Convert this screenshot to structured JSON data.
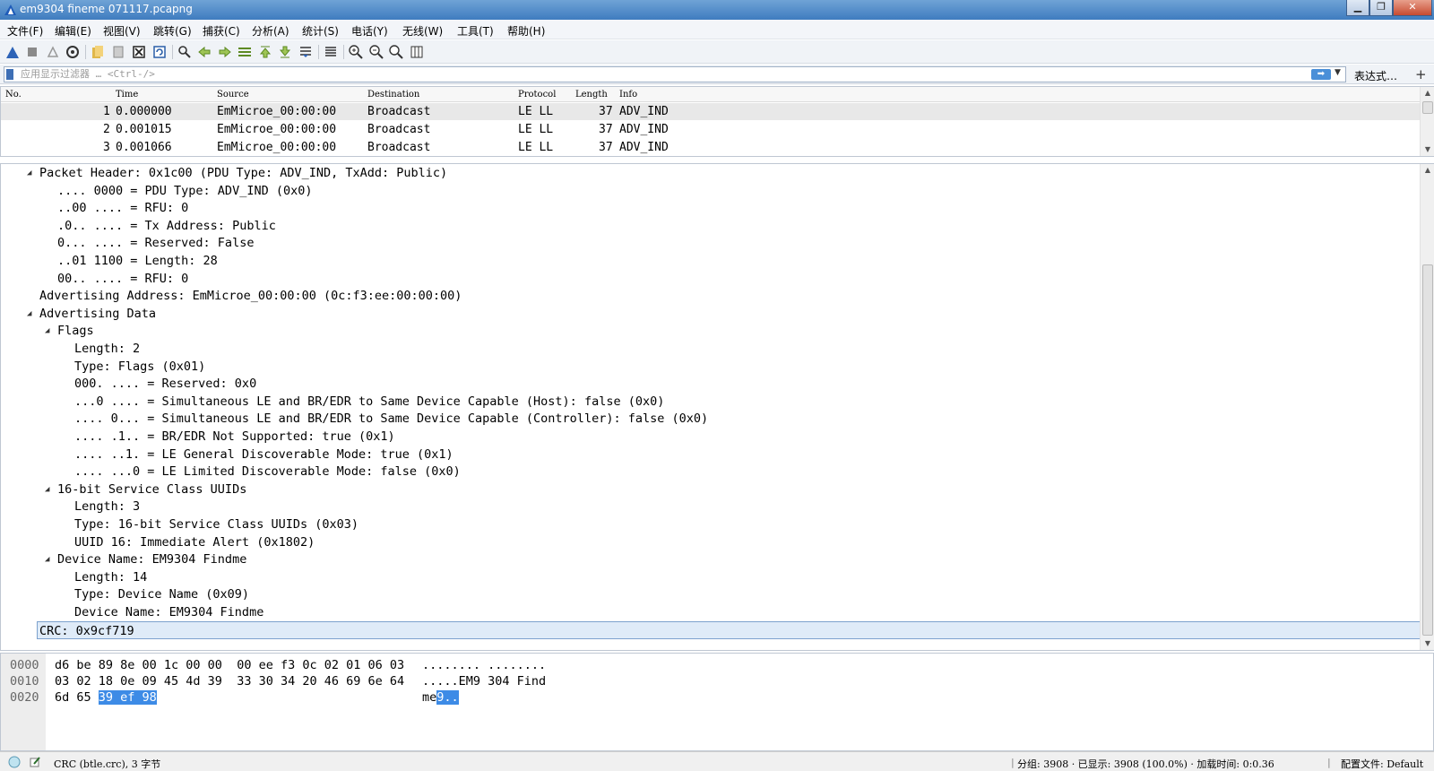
{
  "window": {
    "title": "em9304 fineme 071117.pcapng"
  },
  "menu": [
    "文件(F)",
    "编辑(E)",
    "视图(V)",
    "跳转(G)",
    "捕获(C)",
    "分析(A)",
    "统计(S)",
    "电话(Y)",
    "无线(W)",
    "工具(T)",
    "帮助(H)"
  ],
  "filter": {
    "placeholder": "应用显示过滤器 … <Ctrl-/>",
    "expression_label": "表达式…",
    "add_label": "+"
  },
  "packet_list": {
    "columns": [
      "No.",
      "Time",
      "Source",
      "Destination",
      "Protocol",
      "Length",
      "Info"
    ],
    "rows": [
      {
        "no": "1",
        "time": "0.000000",
        "source": "EmMicroe_00:00:00",
        "destination": "Broadcast",
        "protocol": "LE LL",
        "length": "37",
        "info": "ADV_IND"
      },
      {
        "no": "2",
        "time": "0.001015",
        "source": "EmMicroe_00:00:00",
        "destination": "Broadcast",
        "protocol": "LE LL",
        "length": "37",
        "info": "ADV_IND"
      },
      {
        "no": "3",
        "time": "0.001066",
        "source": "EmMicroe_00:00:00",
        "destination": "Broadcast",
        "protocol": "LE LL",
        "length": "37",
        "info": "ADV_IND"
      }
    ]
  },
  "details": [
    {
      "text": "Packet Header: 0x1c00 (PDU Type: ADV_IND, TxAdd: Public)",
      "toggle": "open",
      "level": 1
    },
    {
      "text": ".... 0000 = PDU Type: ADV_IND (0x0)",
      "level": 2
    },
    {
      "text": "..00 .... = RFU: 0",
      "level": 2
    },
    {
      "text": ".0.. .... = Tx Address: Public",
      "level": 2
    },
    {
      "text": "0... .... = Reserved: False",
      "level": 2
    },
    {
      "text": "..01 1100 = Length: 28",
      "level": 2
    },
    {
      "text": "00.. .... = RFU: 0",
      "level": 2
    },
    {
      "text": "Advertising Address: EmMicroe_00:00:00 (0c:f3:ee:00:00:00)",
      "level": 1
    },
    {
      "text": "Advertising Data",
      "toggle": "open",
      "level": 1
    },
    {
      "text": "Flags",
      "toggle": "open",
      "level": 2
    },
    {
      "text": "Length: 2",
      "level": 3
    },
    {
      "text": "Type: Flags (0x01)",
      "level": 3
    },
    {
      "text": "000. .... = Reserved: 0x0",
      "level": 3
    },
    {
      "text": "...0 .... = Simultaneous LE and BR/EDR to Same Device Capable (Host): false (0x0)",
      "level": 3
    },
    {
      "text": ".... 0... = Simultaneous LE and BR/EDR to Same Device Capable (Controller): false (0x0)",
      "level": 3
    },
    {
      "text": ".... .1.. = BR/EDR Not Supported: true (0x1)",
      "level": 3
    },
    {
      "text": ".... ..1. = LE General Discoverable Mode: true (0x1)",
      "level": 3
    },
    {
      "text": ".... ...0 = LE Limited Discoverable Mode: false (0x0)",
      "level": 3
    },
    {
      "text": "16-bit Service Class UUIDs",
      "toggle": "open",
      "level": 2
    },
    {
      "text": "Length: 3",
      "level": 3
    },
    {
      "text": "Type: 16-bit Service Class UUIDs (0x03)",
      "level": 3
    },
    {
      "text": "UUID 16: Immediate Alert (0x1802)",
      "level": 3
    },
    {
      "text": "Device Name: EM9304 Findme",
      "toggle": "open",
      "level": 2
    },
    {
      "text": "Length: 14",
      "level": 3
    },
    {
      "text": "Type: Device Name (0x09)",
      "level": 3
    },
    {
      "text": "Device Name: EM9304 Findme",
      "level": 3
    },
    {
      "text": "CRC: 0x9cf719",
      "level": 1,
      "selected": true
    }
  ],
  "hex": [
    {
      "offset": "0000",
      "bytes": "d6 be 89 8e 00 1c 00 00  00 ee f3 0c 02 01 06 03",
      "ascii": "........ ........"
    },
    {
      "offset": "0010",
      "bytes": "03 02 18 0e 09 45 4d 39  33 30 34 20 46 69 6e 64",
      "ascii": ".....EM9 304 Find"
    },
    {
      "offset": "0020",
      "bytes_plain": "6d 65 ",
      "bytes_hl": "39 ef 98",
      "ascii_plain": "me",
      "ascii_hl": "9.."
    }
  ],
  "status": {
    "field": "CRC (btle.crc), 3 字节",
    "packets": "分组: 3908 · 已显示: 3908 (100.0%) · 加载时间: 0:0.36",
    "profile": "配置文件: Default"
  },
  "colors": {
    "selection": "#3d8be6",
    "title_bar": "#3f7cbf"
  }
}
